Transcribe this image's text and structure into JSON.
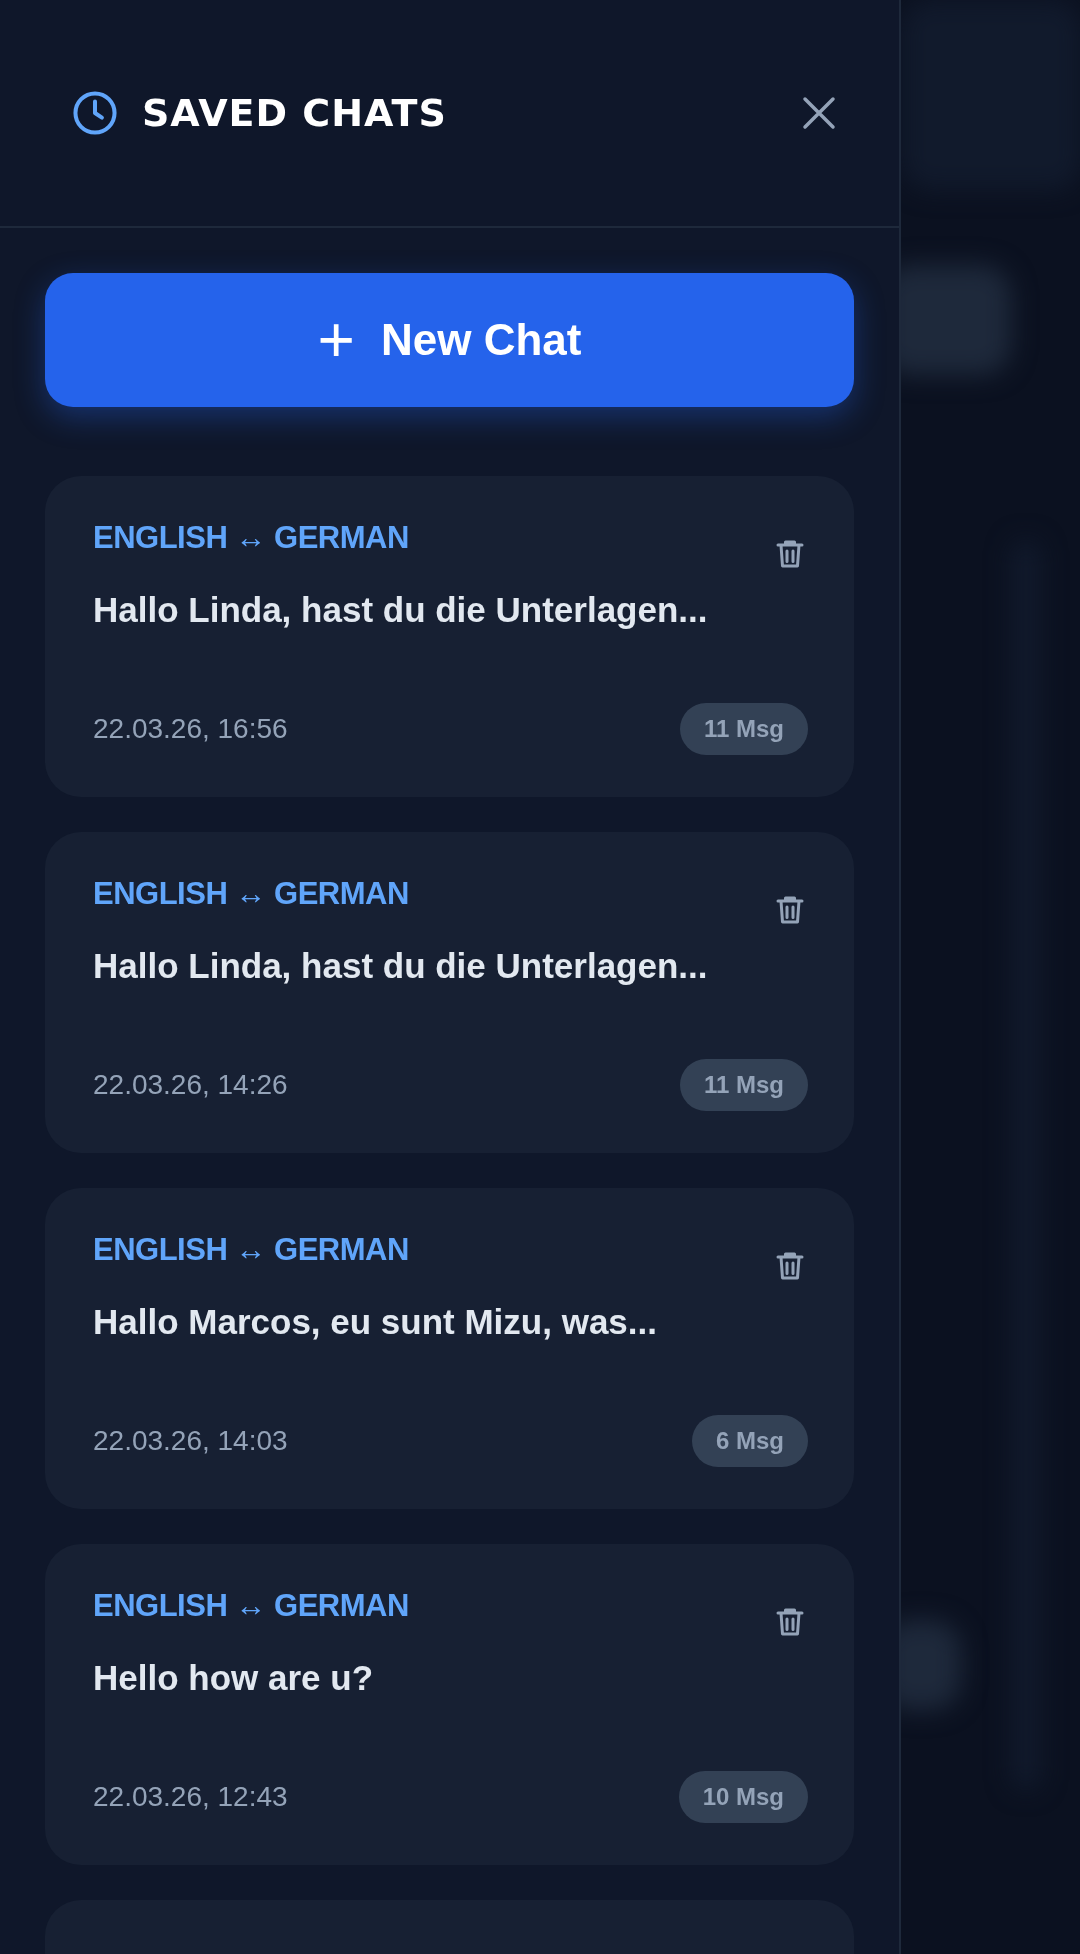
{
  "panel": {
    "title": "SAVED CHATS"
  },
  "new_chat_button": {
    "icon": "+",
    "label": "New Chat"
  },
  "chats": [
    {
      "languages": "ENGLISH ↔ GERMAN",
      "title": "Hallo Linda, hast du die Unterlagen...",
      "date": "22.03.26, 16:56",
      "count": "11 Msg"
    },
    {
      "languages": "ENGLISH ↔ GERMAN",
      "title": "Hallo Linda, hast du die Unterlagen...",
      "date": "22.03.26, 14:26",
      "count": "11 Msg"
    },
    {
      "languages": "ENGLISH ↔ GERMAN",
      "title": "Hallo Marcos, eu sunt Mizu, was...",
      "date": "22.03.26, 14:03",
      "count": "6 Msg"
    },
    {
      "languages": "ENGLISH ↔ GERMAN",
      "title": "Hello how are u?",
      "date": "22.03.26, 12:43",
      "count": "10 Msg"
    }
  ]
}
